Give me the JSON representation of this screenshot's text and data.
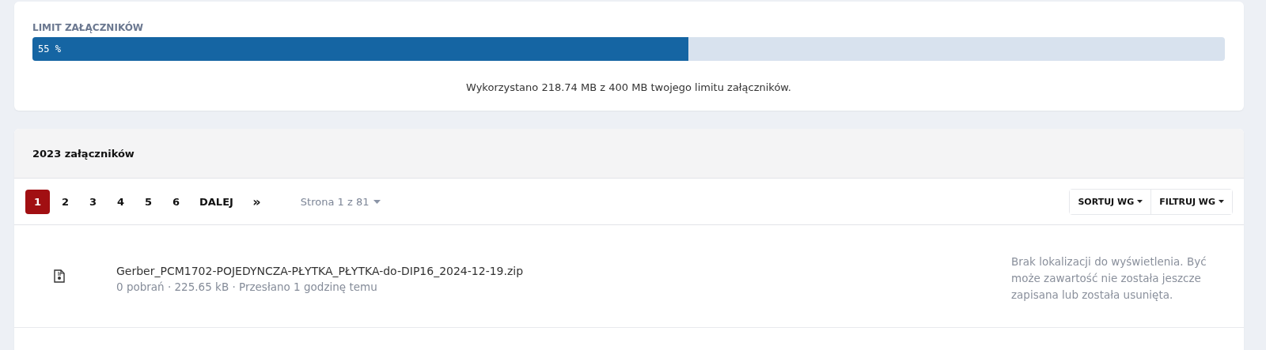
{
  "limit": {
    "title": "LIMIT ZAŁĄCZNIKÓW",
    "level": 0.55,
    "reading": "55 %",
    "summary": "Wykorzystano 218.74 MB z 400 MB twojego limitu załączników."
  },
  "attachments": {
    "heading": "2023 załączników",
    "pages": [
      {
        "label": "1",
        "selected": true
      },
      {
        "label": "2",
        "selected": false
      },
      {
        "label": "3",
        "selected": false
      },
      {
        "label": "4",
        "selected": false
      },
      {
        "label": "5",
        "selected": false
      },
      {
        "label": "6",
        "selected": false
      }
    ],
    "next": "DALEJ",
    "last": "»",
    "page_select": "Strona 1 z 81",
    "sort": "SORTUJ WG",
    "filter": "FILTRUJ WG",
    "files": [
      {
        "name": "Gerber_PCM1702-POJEDYNCZA-PŁYTKA_PŁYTKA-do-DIP16_2024-12-19.zip",
        "meta": "0 pobrań · 225.65 kB · Przesłano 1 godzinę temu",
        "note": "Brak lokalizacji do wyświetlenia. Być może zawartość nie została jeszcze zapisana lub została usunięta."
      }
    ]
  }
}
